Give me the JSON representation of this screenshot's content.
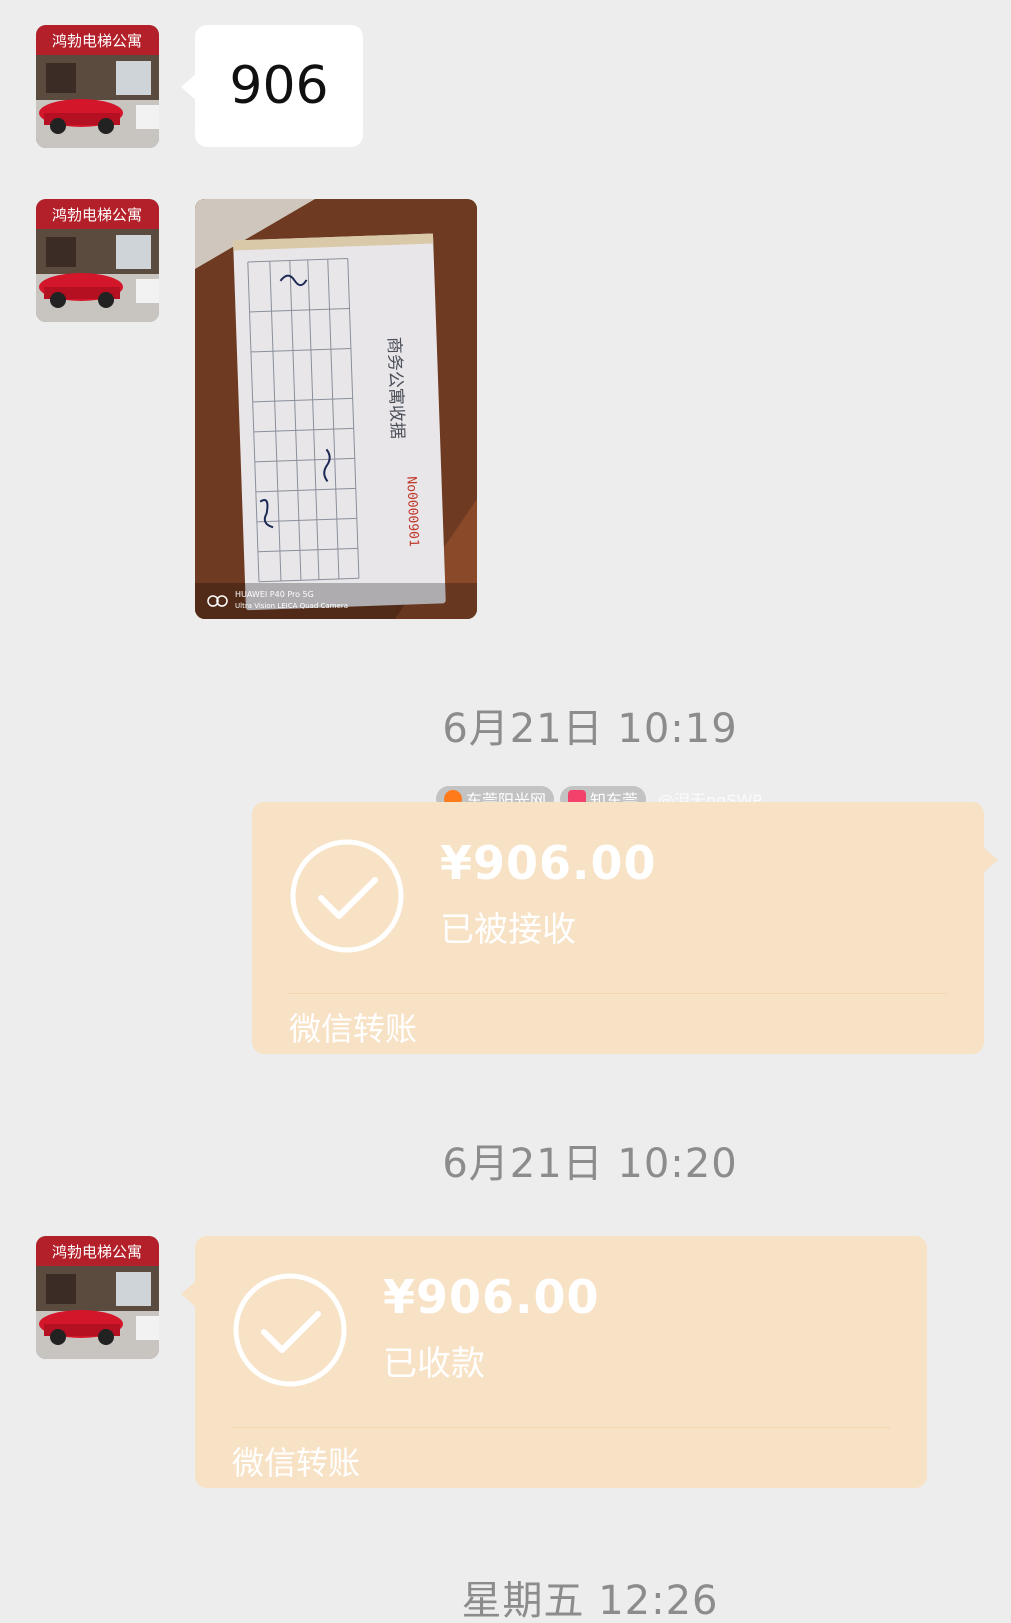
{
  "messages": {
    "text_reply": "906",
    "transfer_sent": {
      "amount": "¥906.00",
      "status": "已被接收",
      "footer": "微信转账"
    },
    "transfer_received": {
      "amount": "¥906.00",
      "status": "已收款",
      "footer": "微信转账"
    }
  },
  "photo": {
    "receipt_title": "商务公寓收据",
    "receipt_number": "No0000901",
    "camera_line1": "HUAWEI P40 Pro 5G",
    "camera_line2": "Ultra Vision LEICA Quad Camera"
  },
  "avatar": {
    "sign_text": "鸿勃电梯公寓"
  },
  "timestamps": {
    "first": "6月21日 10:19",
    "second": "6月21日 10:20",
    "third": "星期五 12:26"
  },
  "watermark": {
    "site": "东莞阳光网",
    "brand": "知东莞",
    "handle": "@泪无nqSWP"
  },
  "colors": {
    "background": "#ededed",
    "transfer_bubble": "#f8e2c6",
    "timestamp_text": "#8c8c8c"
  },
  "icons": {
    "transfer_status": "check-circle-icon"
  }
}
